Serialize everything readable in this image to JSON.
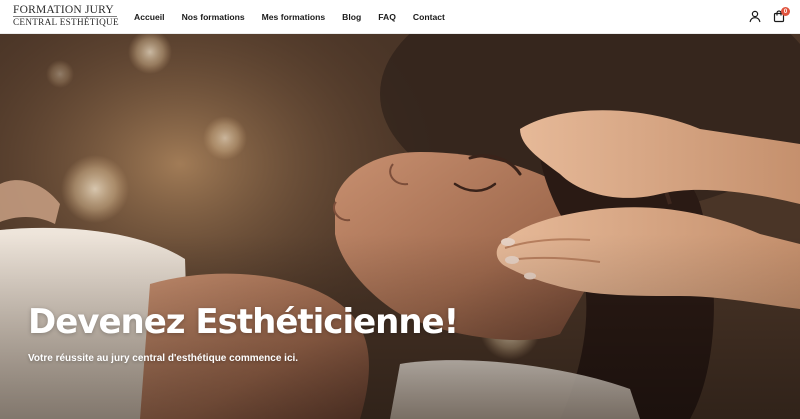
{
  "brand": {
    "line1": "Formation Jury",
    "line2": "Central Esthétique"
  },
  "nav": {
    "items": [
      "Accueil",
      "Nos formations",
      "Mes formations",
      "Blog",
      "FAQ",
      "Contact"
    ]
  },
  "header_icons": {
    "account": "user-icon",
    "cart": "shopping-bag-icon",
    "cart_count": "0"
  },
  "hero": {
    "title": "Devenez Esthéticienne!",
    "subtitle": "Votre réussite au jury central d'esthétique commence ici.",
    "image": "spa-facial-massage-photo"
  },
  "colors": {
    "badge": "#e0533d",
    "text_dark": "#1a1a1a",
    "hero_text": "#ffffff"
  }
}
